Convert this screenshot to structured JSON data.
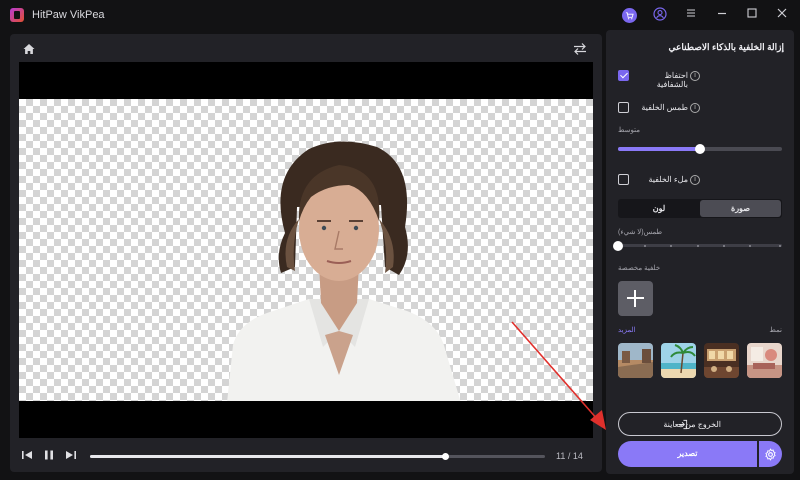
{
  "app": {
    "title": "HitPaw VikPea"
  },
  "titlebar": {
    "icons": [
      "cart-icon",
      "user-icon",
      "menu-icon",
      "minimize-icon",
      "maximize-icon",
      "close-icon"
    ]
  },
  "preview": {
    "icons": [
      "home-icon",
      "swap-icon"
    ],
    "playback": {
      "current_frame": "11",
      "separator": "/",
      "total_frames": "14",
      "counter_text": "11 / 14",
      "progress": 0.78
    }
  },
  "panel": {
    "title": "إزالة الخلفية بالذكاء الاصطناعي",
    "keep_transparency": {
      "label": "احتفاظ بالشفافية",
      "checked": true
    },
    "blur_background": {
      "label": "طمس الخلفية",
      "checked": false,
      "level_label": "متوسط",
      "level": 0.5
    },
    "fill_background": {
      "label": "ملء الخلفية",
      "checked": false
    },
    "fill_tabs": {
      "image": "صورة",
      "color": "لون",
      "selected": "image"
    },
    "blur_strength": {
      "label": "طمس(لا شيء)",
      "value": 0,
      "ticks": 5
    },
    "custom_background_label": "خلفية مخصصة",
    "style_label": "نمط",
    "more_label": "المزيد",
    "presets": [
      "street-preset",
      "beach-preset",
      "cafe-preset",
      "interior-preset"
    ],
    "exit_preview_label": "الخروج من معاينة",
    "export_label": "تصدير"
  },
  "colors": {
    "accent": "#8a79f7",
    "background": "#121214",
    "panel": "#222227",
    "arrow": "#e0302c"
  }
}
